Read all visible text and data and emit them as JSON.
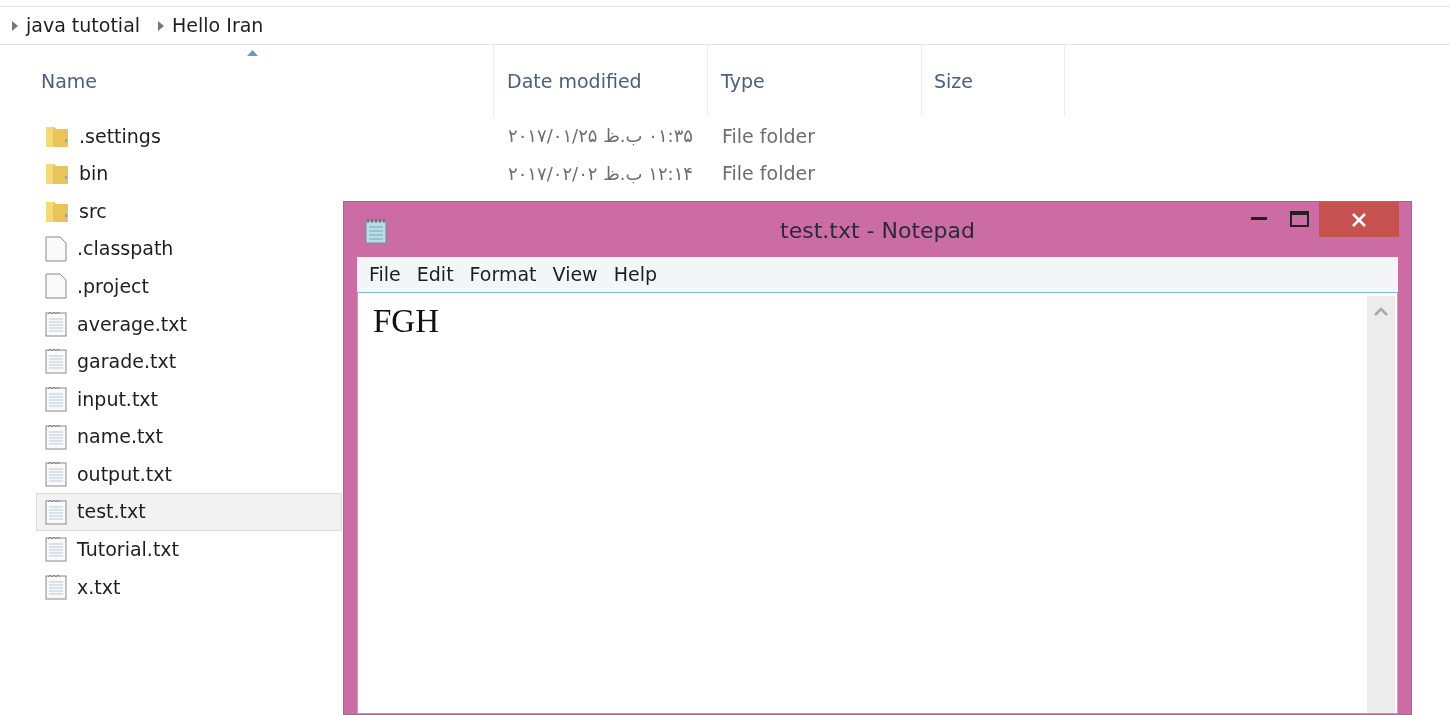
{
  "breadcrumb": [
    "java tutotial",
    "Hello Iran"
  ],
  "columns": [
    {
      "label": "Name",
      "sorted": true
    },
    {
      "label": "Date modified",
      "sorted": false
    },
    {
      "label": "Type",
      "sorted": false
    },
    {
      "label": "Size",
      "sorted": false
    }
  ],
  "files": [
    {
      "name": ".settings",
      "kind": "folder",
      "date": "۰۱:۳۵ ب.ظ ۲۰۱۷/۰۱/۲۵",
      "type": "File folder",
      "selected": false
    },
    {
      "name": "bin",
      "kind": "folder",
      "date": "۱۲:۱۴ ب.ظ ۲۰۱۷/۰۲/۰۲",
      "type": "File folder",
      "selected": false
    },
    {
      "name": "src",
      "kind": "folder",
      "selected": false
    },
    {
      "name": ".classpath",
      "kind": "file",
      "selected": false
    },
    {
      "name": ".project",
      "kind": "file",
      "selected": false
    },
    {
      "name": "average.txt",
      "kind": "text",
      "selected": false
    },
    {
      "name": "garade.txt",
      "kind": "text",
      "selected": false
    },
    {
      "name": "input.txt",
      "kind": "text",
      "selected": false
    },
    {
      "name": "name.txt",
      "kind": "text",
      "selected": false
    },
    {
      "name": "output.txt",
      "kind": "text",
      "selected": false
    },
    {
      "name": "test.txt",
      "kind": "text",
      "selected": true
    },
    {
      "name": "Tutorial.txt",
      "kind": "text",
      "selected": false
    },
    {
      "name": "x.txt",
      "kind": "text",
      "selected": false
    }
  ],
  "notepad": {
    "title": "test.txt - Notepad",
    "menu": [
      "File",
      "Edit",
      "Format",
      "View",
      "Help"
    ],
    "content": "FGH"
  }
}
